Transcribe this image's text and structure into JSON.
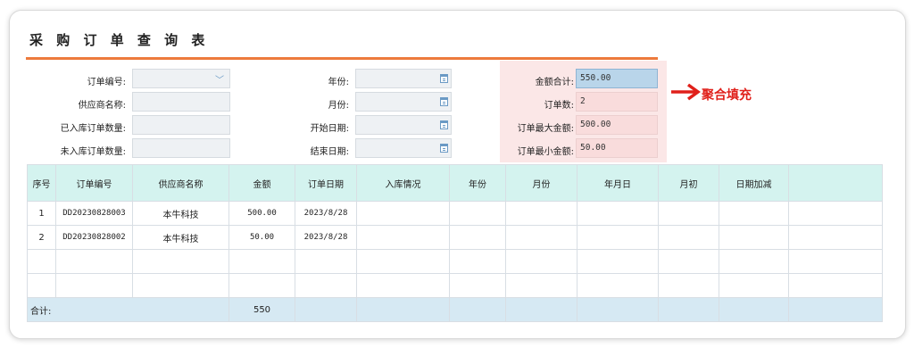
{
  "title": "采 购 订 单 查 询 表",
  "query": {
    "order_no": {
      "label": "订单编号:",
      "value": ""
    },
    "supplier": {
      "label": "供应商名称:",
      "value": ""
    },
    "in_stock_count": {
      "label": "已入库订单数量:",
      "value": ""
    },
    "not_in_stock_count": {
      "label": "未入库订单数量:",
      "value": ""
    },
    "year": {
      "label": "年份:",
      "value": ""
    },
    "month": {
      "label": "月份:",
      "value": ""
    },
    "start_date": {
      "label": "开始日期:",
      "value": ""
    },
    "end_date": {
      "label": "结束日期:",
      "value": ""
    },
    "amount_total": {
      "label": "金额合计:",
      "value": "550.00"
    },
    "order_count": {
      "label": "订单数:",
      "value": "2"
    },
    "max_amount": {
      "label": "订单最大金额:",
      "value": "500.00"
    },
    "min_amount": {
      "label": "订单最小金额:",
      "value": "50.00"
    }
  },
  "annotation": "聚合填充",
  "table": {
    "headers": [
      "序号",
      "订单编号",
      "供应商名称",
      "金额",
      "订单日期",
      "入库情况",
      "年份",
      "月份",
      "年月日",
      "月初",
      "日期加减",
      ""
    ],
    "rows": [
      [
        "1",
        "DD20230828003",
        "本牛科技",
        "500.00",
        "2023/8/28",
        "",
        "",
        "",
        "",
        "",
        "",
        ""
      ],
      [
        "2",
        "DD20230828002",
        "本牛科技",
        "50.00",
        "2023/8/28",
        "",
        "",
        "",
        "",
        "",
        "",
        ""
      ],
      [
        "",
        "",
        "",
        "",
        "",
        "",
        "",
        "",
        "",
        "",
        "",
        ""
      ],
      [
        "",
        "",
        "",
        "",
        "",
        "",
        "",
        "",
        "",
        "",
        "",
        ""
      ]
    ],
    "summary": {
      "label": "合计:",
      "amount": "550"
    }
  },
  "colors": {
    "accent_line": "#ed7a3c",
    "header_bg": "#d4f3ef",
    "summary_bg": "#d6e9f3",
    "aggregate_bg": "#fbe7e7",
    "annotation": "#e0201a"
  }
}
